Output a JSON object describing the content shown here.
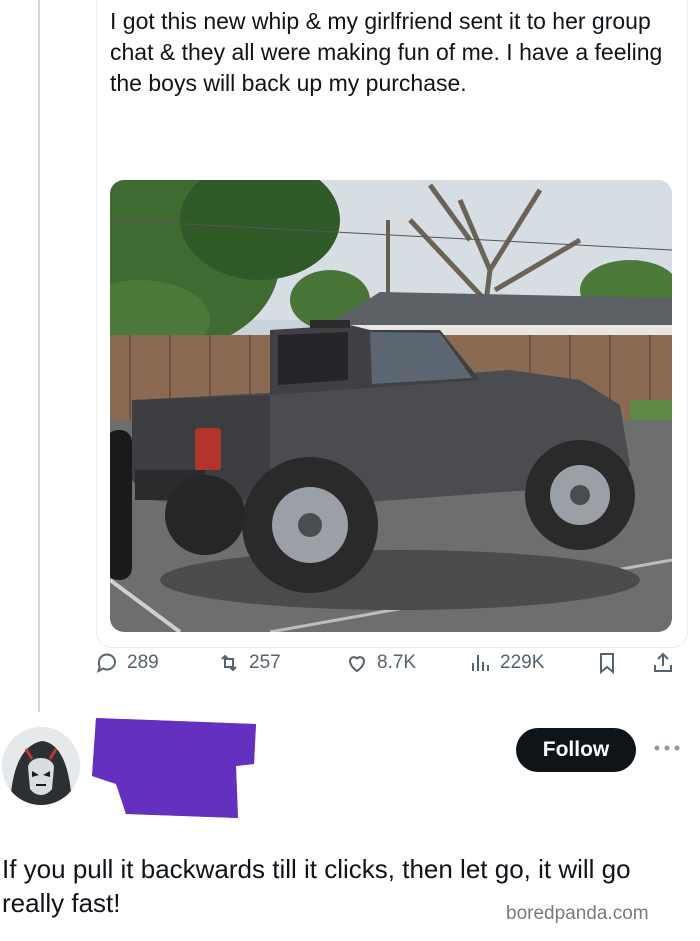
{
  "post": {
    "text": "I got this new whip & my girlfriend sent it to her group chat & they all were making fun of me. I have a feeling the boys will back up my purchase.",
    "image_desc_icon": "photo-of-gray-pickup-truck"
  },
  "stats": {
    "replies": "289",
    "reposts": "257",
    "likes": "8.7K",
    "views": "229K"
  },
  "reply": {
    "follow_label": "Follow",
    "text": "If you pull it backwards till it clicks, then let go, it will go really fast!"
  },
  "watermark": "boredpanda.com",
  "colors": {
    "text": "#0f1419",
    "muted": "#536471",
    "follow_bg": "#0f1419",
    "redaction": "#5b2bb5",
    "thread_line": "#cfd9de"
  }
}
